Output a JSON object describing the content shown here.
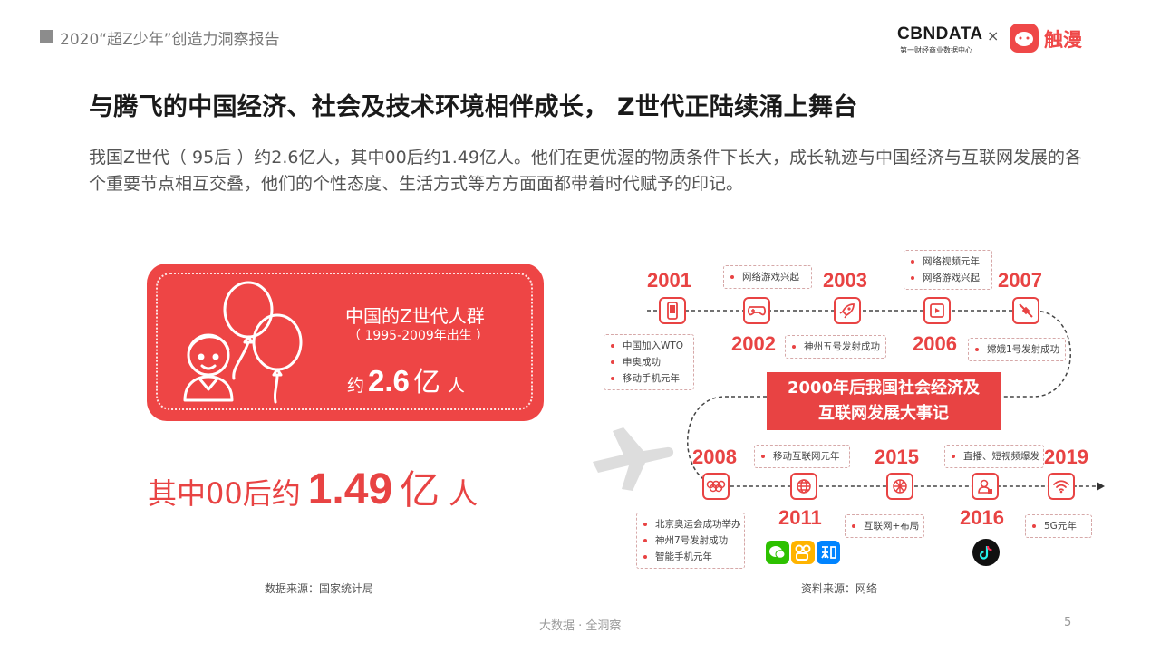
{
  "header": {
    "report_title": "2020“超Z少年”创造力洞察报告",
    "cbn_logo": "CBNDATA",
    "cbn_sub": "第一财经商业数据中心",
    "times": "×",
    "partner_logo": "触漫"
  },
  "title": "与腾飞的中国经济、社会及技术环境相伴成长， Z世代正陆续涌上舞台",
  "description": "我国Z世代（ 95后 ）约2.6亿人，其中00后约1.49亿人。他们在更优渥的物质条件下长大，成长轨迹与中国经济与互联网发展的各个重要节点相互交叠，他们的个性态度、生活方式等方方面面都带着时代赋予的印记。",
  "card": {
    "label": "中国的Z世代人群",
    "sub": "（ 1995-2009年出生 ）",
    "prefix": "约",
    "number": "2.6",
    "unit": "亿",
    "suffix": "人"
  },
  "post00": {
    "prefix": "其中00后约",
    "number": "1.49",
    "unit": "亿",
    "suffix": "人"
  },
  "source_left": "数据来源：国家统计局",
  "source_right": "资料来源：网络",
  "banner": {
    "line1": "2000年后我国社会经济及",
    "line2": "互联网发展大事记"
  },
  "timeline": {
    "y2001": "2001",
    "y2002": "2002",
    "y2003": "2003",
    "y2006": "2006",
    "y2007": "2007",
    "y2008": "2008",
    "y2011": "2011",
    "y2015": "2015",
    "y2016": "2016",
    "y2019": "2019",
    "e2001": [
      "中国加入WTO",
      "申奥成功",
      "移动手机元年"
    ],
    "e2002": [
      "网络游戏兴起"
    ],
    "e2003": [
      "神州五号发射成功"
    ],
    "e2006": [
      "网络视频元年",
      "网络游戏兴起"
    ],
    "e2007": [
      "嫦娥1号发射成功"
    ],
    "e2008": [
      "北京奥运会成功举办",
      "神州7号发射成功",
      "智能手机元年"
    ],
    "e2011": [
      "移动互联网元年"
    ],
    "e2015": [
      "互联网+布局"
    ],
    "e2016": [
      "直播、短视频爆发"
    ],
    "e2019": [
      "5G元年"
    ]
  },
  "footer": "大数据 · 全洞察",
  "page_number": "5",
  "colors": {
    "accent": "#e84343",
    "card": "#ee4545"
  }
}
